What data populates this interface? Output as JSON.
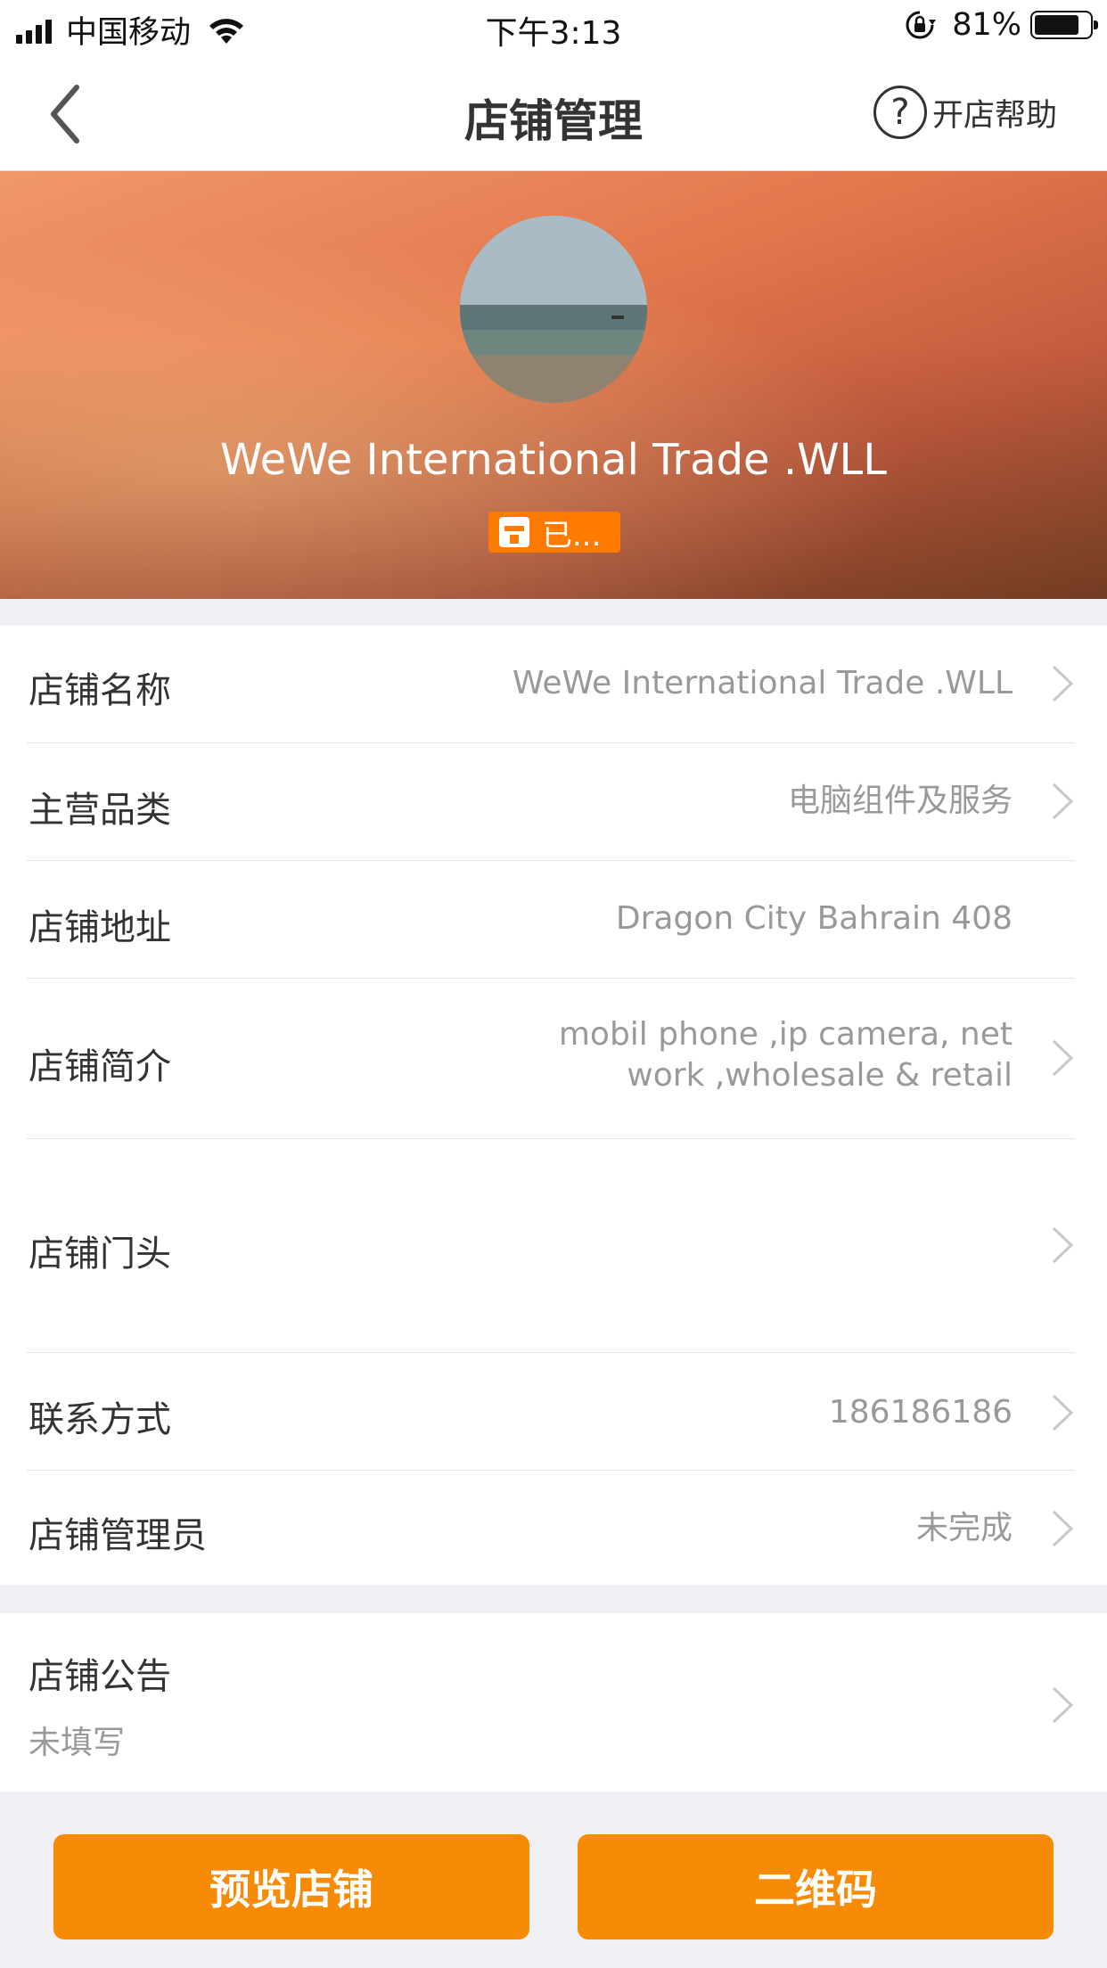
{
  "status_bar": {
    "carrier": "中国移动",
    "time": "下午3:13",
    "battery": "81%"
  },
  "nav": {
    "title": "店铺管理",
    "help_label": "开店帮助"
  },
  "shop": {
    "name": "WeWe  International Trade .WLL",
    "badge_label": "已..."
  },
  "rows": {
    "name": {
      "label": "店铺名称",
      "value": "WeWe  International Trade .WLL"
    },
    "category": {
      "label": "主营品类",
      "value": "电脑组件及服务"
    },
    "address": {
      "label": "店铺地址",
      "value": "Dragon City Bahrain 408"
    },
    "intro": {
      "label": "店铺简介",
      "value_line1": "mobil phone ,ip camera, net",
      "value_line2": "work ,wholesale & retail"
    },
    "storefront": {
      "label": "店铺门头"
    },
    "contact": {
      "label": "联系方式",
      "value": "186186186"
    },
    "admin": {
      "label": "店铺管理员",
      "value": "未完成"
    }
  },
  "notice": {
    "label": "店铺公告",
    "value": "未填写"
  },
  "buttons": {
    "preview": "预览店铺",
    "qrcode": "二维码"
  },
  "colors": {
    "accent": "#f78b05",
    "badge": "#ff7a00"
  }
}
